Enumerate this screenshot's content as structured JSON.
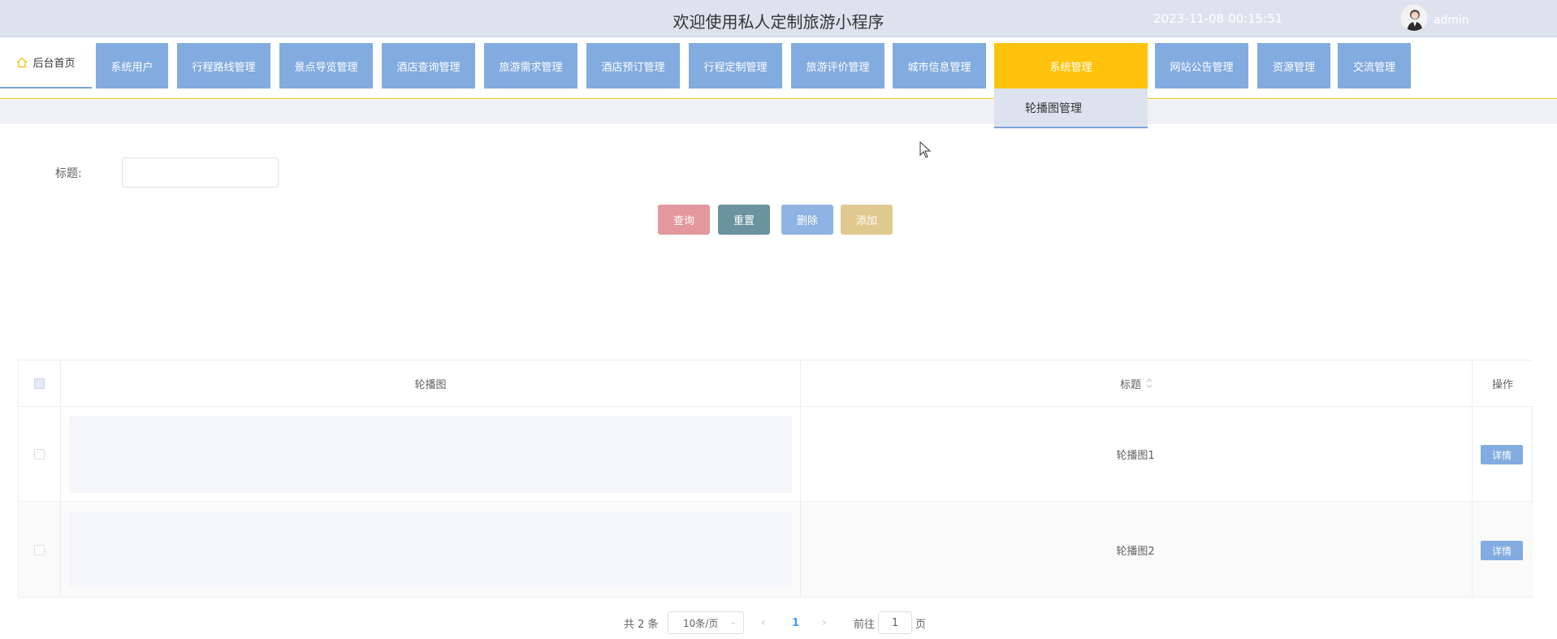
{
  "header": {
    "title": "欢迎使用私人定制旅游小程序",
    "datetime": "2023-11-08 00:15:51",
    "username": "admin"
  },
  "nav": {
    "home_label": "后台首页",
    "items": [
      {
        "label": "系统用户"
      },
      {
        "label": "行程路线管理"
      },
      {
        "label": "景点导览管理"
      },
      {
        "label": "酒店查询管理"
      },
      {
        "label": "旅游需求管理"
      },
      {
        "label": "酒店预订管理"
      },
      {
        "label": "行程定制管理"
      },
      {
        "label": "旅游评价管理"
      },
      {
        "label": "城市信息管理"
      },
      {
        "label": "系统管理",
        "active": true
      },
      {
        "label": "网站公告管理"
      },
      {
        "label": "资源管理"
      },
      {
        "label": "交流管理"
      }
    ],
    "submenu": {
      "label": "轮播图管理"
    }
  },
  "search": {
    "title_label": "标题:",
    "title_value": "",
    "buttons": {
      "query": "查询",
      "reset": "重置",
      "delete": "删除",
      "add": "添加"
    }
  },
  "table": {
    "columns": {
      "image": "轮播图",
      "title": "标题",
      "actions": "操作"
    },
    "rows": [
      {
        "title": "轮播图1",
        "action": "详情"
      },
      {
        "title": "轮播图2",
        "action": "详情"
      }
    ]
  },
  "pagination": {
    "total": "共 2 条",
    "page_size": "10条/页",
    "current_page": "1",
    "goto_label": "前往",
    "goto_value": "1",
    "page_suffix": "页"
  },
  "colors": {
    "nav_button": "#82abe0",
    "nav_active": "#ffc30e",
    "query_button": "#e3989e",
    "reset_button": "#6a929f",
    "delete_button": "#8fb3e2",
    "add_button": "#e0c98f",
    "header_bg": "#dce3ef"
  }
}
